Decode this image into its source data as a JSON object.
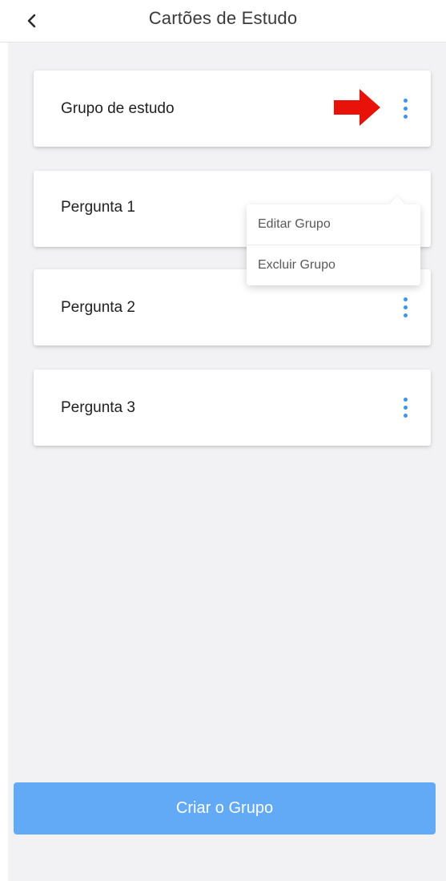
{
  "header": {
    "title": "Cartões de Estudo",
    "back_icon": "chevron-left-icon"
  },
  "cards": [
    {
      "label": "Grupo de estudo",
      "menu_icon": "more-vertical-icon"
    },
    {
      "label": "Pergunta 1",
      "menu_icon": "more-vertical-icon"
    },
    {
      "label": "Pergunta 2",
      "menu_icon": "more-vertical-icon"
    },
    {
      "label": "Pergunta 3",
      "menu_icon": "more-vertical-icon"
    }
  ],
  "context_menu": {
    "items": [
      {
        "label": "Editar Grupo"
      },
      {
        "label": "Excluir Grupo"
      }
    ]
  },
  "annotation": {
    "icon": "arrow-right-icon",
    "color": "#e8120b"
  },
  "footer": {
    "create_button_label": "Criar o Grupo"
  },
  "colors": {
    "accent": "#3b95f0",
    "button_bg": "#62aaf6",
    "content_bg": "#f2f2f4"
  }
}
